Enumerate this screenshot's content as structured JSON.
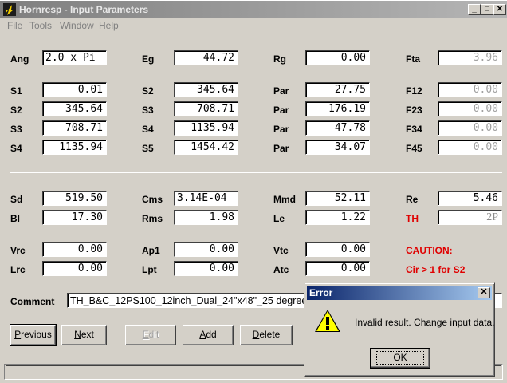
{
  "window": {
    "title": "Hornresp - Input Parameters"
  },
  "menu": [
    "File",
    "Tools",
    "Window",
    "Help"
  ],
  "labels": {
    "ang": "Ang",
    "eg": "Eg",
    "rg": "Rg",
    "fta": "Fta",
    "s1": "S1",
    "s2a": "S2",
    "par1": "Par",
    "f12": "F12",
    "s2b": "S2",
    "s3a": "S3",
    "par2": "Par",
    "f23": "F23",
    "s3b": "S3",
    "s4a": "S4",
    "par3": "Par",
    "f34": "F34",
    "s4b": "S4",
    "s5": "S5",
    "par4": "Par",
    "f45": "F45",
    "sd": "Sd",
    "cms": "Cms",
    "mmd": "Mmd",
    "re": "Re",
    "bl": "Bl",
    "rms": "Rms",
    "le": "Le",
    "th": "TH",
    "vrc": "Vrc",
    "ap1": "Ap1",
    "vtc": "Vtc",
    "caution": "CAUTION:",
    "lrc": "Lrc",
    "lpt": "Lpt",
    "atc": "Atc",
    "cir": "Cir > 1 for S2",
    "comment": "Comment"
  },
  "fields": {
    "ang": "2.0 x Pi",
    "eg": "44.72",
    "rg": "0.00",
    "fta": "3.96",
    "s1": "0.01",
    "s2a": "345.64",
    "par1": "27.75",
    "f12": "0.00",
    "s2b": "345.64",
    "s3a": "708.71",
    "par2": "176.19",
    "f23": "0.00",
    "s3b": "708.71",
    "s4a": "1135.94",
    "par3": "47.78",
    "f34": "0.00",
    "s4b": "1135.94",
    "s5": "1454.42",
    "par4": "34.07",
    "f45": "0.00",
    "sd": "519.50",
    "cms": "3.14E-04",
    "mmd": "52.11",
    "re": "5.46",
    "bl": "17.30",
    "rms": "1.98",
    "le": "1.22",
    "th": "2P",
    "vrc": "0.00",
    "ap1": "0.00",
    "vtc": "0.00",
    "lrc": "0.00",
    "lpt": "0.00",
    "atc": "0.00",
    "comment": "TH_B&C_12PS100_12inch_Dual_24\"x48\"_25 degree"
  },
  "buttons": {
    "previous_pre": "",
    "previous_u": "P",
    "previous_post": "revious",
    "next_pre": "",
    "next_u": "N",
    "next_post": "ext",
    "edit_pre": "",
    "edit_u": "E",
    "edit_post": "dit",
    "add_pre": "",
    "add_u": "A",
    "add_post": "dd",
    "delete_pre": "",
    "delete_u": "D",
    "delete_post": "elete"
  },
  "dialog": {
    "title": "Error",
    "message": "Invalid result.  Change input data.",
    "ok": "OK"
  },
  "colors": {
    "titlebar_inactive": "#9a9a9a",
    "dialog_title": "#0a246a",
    "warning": "#e00000"
  }
}
